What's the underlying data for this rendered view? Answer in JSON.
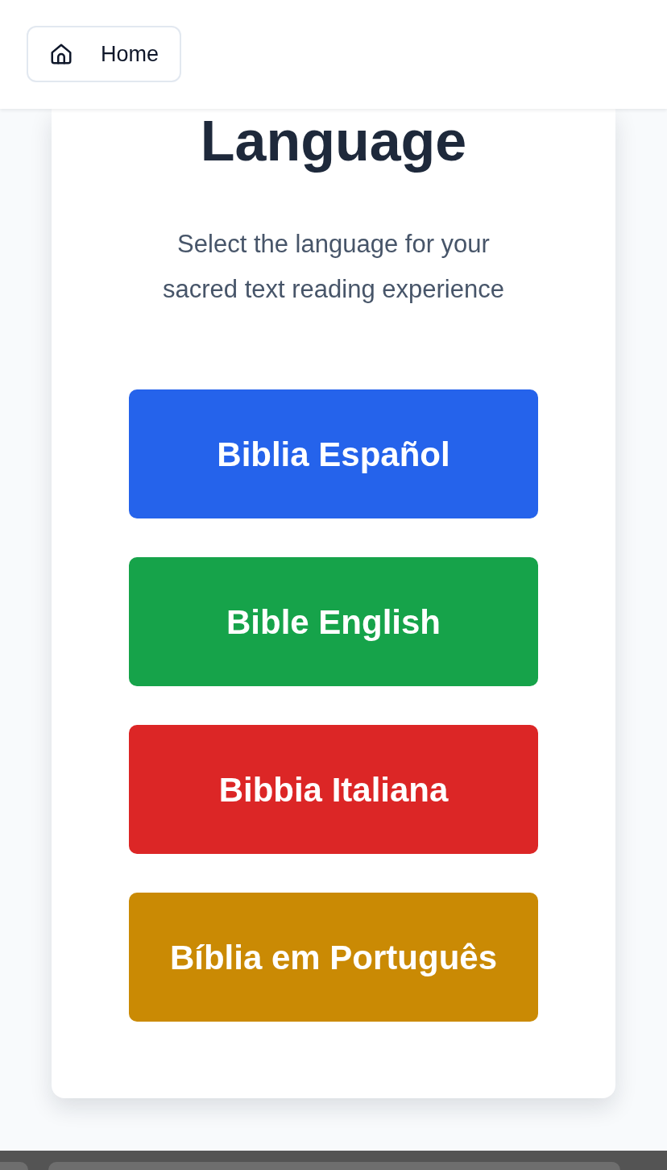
{
  "header": {
    "home_button": {
      "label": "Home"
    }
  },
  "card": {
    "title": "Language",
    "subtitle": "Select the language for your sacred text reading experience"
  },
  "languages": [
    {
      "label": "Biblia Español",
      "color": "#2563eb"
    },
    {
      "label": "Bible English",
      "color": "#16a34a"
    },
    {
      "label": "Bibbia Italiana",
      "color": "#dc2626"
    },
    {
      "label": "Bíblia em Português",
      "color": "#ca8a04"
    }
  ]
}
